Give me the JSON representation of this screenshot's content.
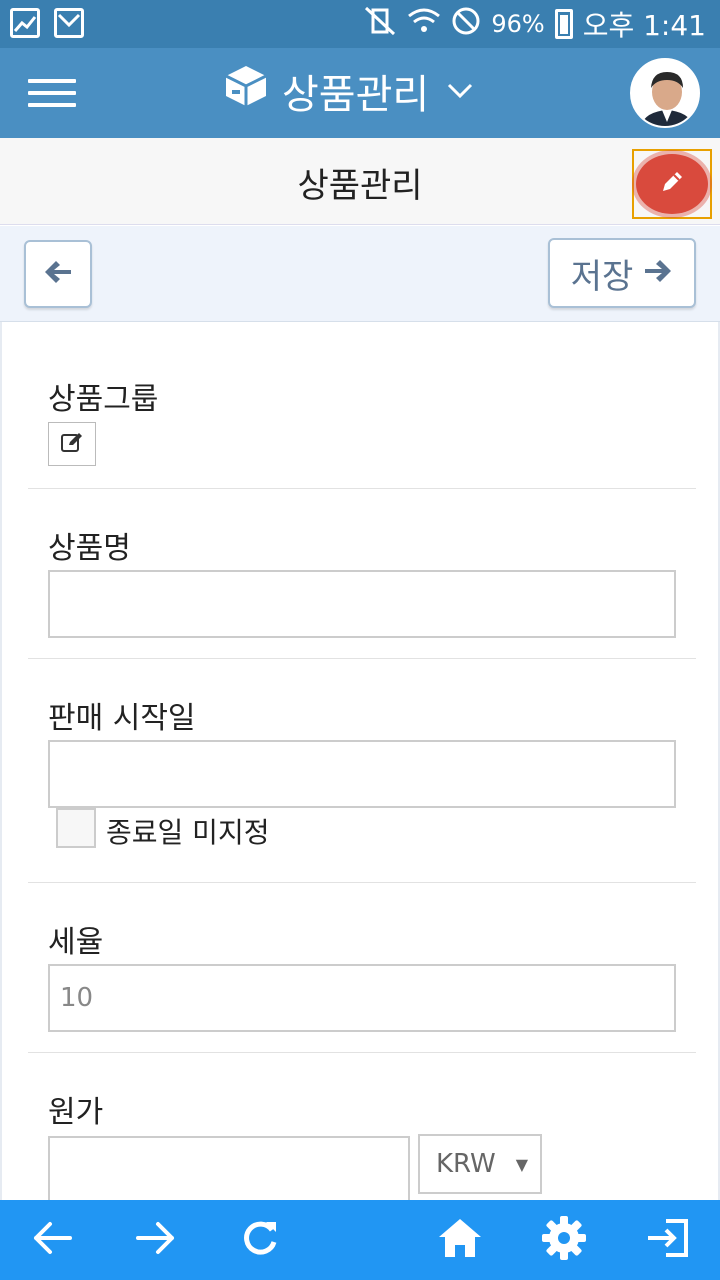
{
  "status_bar": {
    "battery": "96%",
    "time": "오후 1:41"
  },
  "app_bar": {
    "title": "상품관리"
  },
  "page": {
    "title": "상품관리"
  },
  "actions": {
    "save_label": "저장"
  },
  "form": {
    "group_label": "상품그룹",
    "name_label": "상품명",
    "name_value": "",
    "start_date_label": "판매 시작일",
    "start_date_value": "",
    "no_end_date_label": "종료일 미지정",
    "tax_rate_label": "세율",
    "tax_rate_value": "10",
    "cost_label": "원가",
    "cost_value": "",
    "currency_selected": "KRW"
  },
  "colors": {
    "status_bar": "#3a7fb0",
    "app_bar": "#4a8fc2",
    "fab": "#d94a3d",
    "bottom_nav": "#2196f3"
  }
}
